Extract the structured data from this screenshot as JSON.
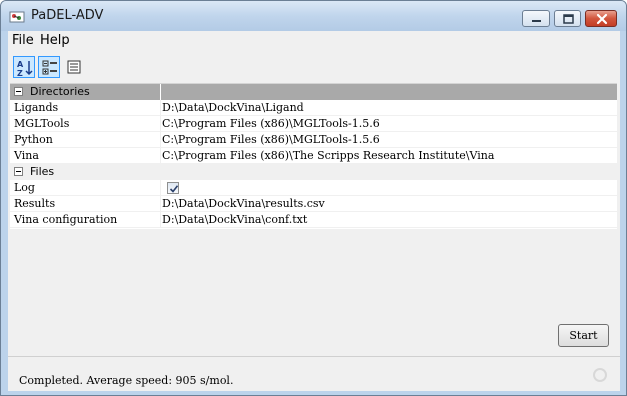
{
  "window": {
    "title": "PaDEL-ADV",
    "app_icon": "padel-app-icon"
  },
  "menu": [
    {
      "label": "File"
    },
    {
      "label": "Help"
    }
  ],
  "toolbar": {
    "buttons": [
      {
        "name": "sort-alphabetical",
        "icon": "sort-az-icon",
        "checked": true
      },
      {
        "name": "categorized-view",
        "icon": "categorized-icon",
        "checked": true
      },
      {
        "name": "property-pages",
        "icon": "property-pages-icon",
        "checked": false
      }
    ]
  },
  "grid": {
    "categories": [
      {
        "label": "Directories",
        "properties": [
          {
            "name": "Ligands",
            "value": "D:\\Data\\DockVina\\Ligand"
          },
          {
            "name": "MGLTools",
            "value": "C:\\Program Files (x86)\\MGLTools-1.5.6"
          },
          {
            "name": "Python",
            "value": "C:\\Program Files (x86)\\MGLTools-1.5.6"
          },
          {
            "name": "Vina",
            "value": "C:\\Program Files (x86)\\The Scripps Research Institute\\Vina"
          }
        ]
      },
      {
        "label": "Files",
        "properties": [
          {
            "name": "Log",
            "value": "",
            "checked": true
          },
          {
            "name": "Results",
            "value": "D:\\Data\\DockVina\\results.csv"
          },
          {
            "name": "Vina configuration",
            "value": "D:\\Data\\DockVina\\conf.txt"
          }
        ]
      }
    ]
  },
  "actions": {
    "start_label": "Start"
  },
  "status": {
    "text": "Completed. Average speed: 905 s/mol."
  },
  "colors": {
    "titlebar": "#c0d5ec",
    "category_selected": "#a9a9a9",
    "close_button": "#d2553d",
    "toolbar_checked": "#cce8ff"
  }
}
